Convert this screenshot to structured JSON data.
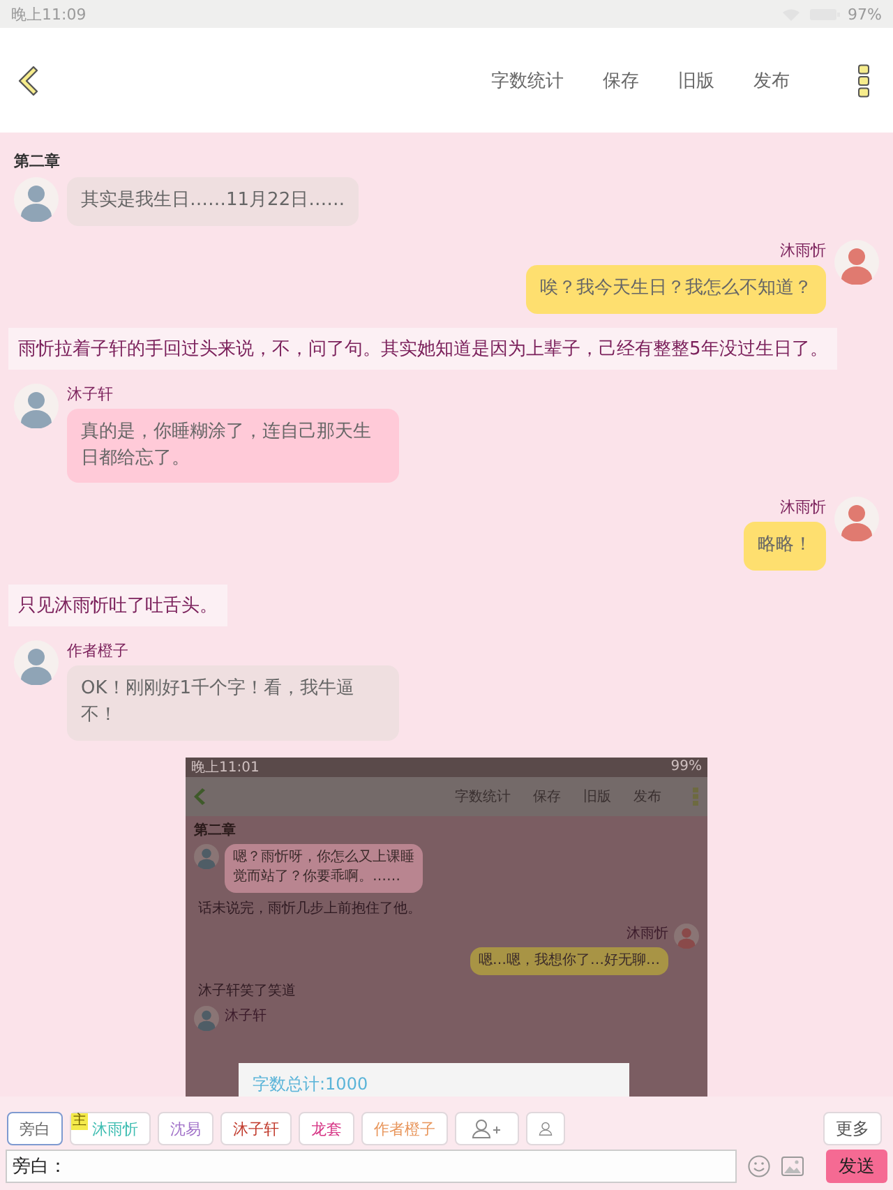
{
  "status_bar": {
    "time": "晚上11:09",
    "battery": "97%"
  },
  "toolbar": {
    "actions": [
      "字数统计",
      "保存",
      "旧版",
      "发布"
    ]
  },
  "chapter_title": "第二章",
  "messages": [
    {
      "kind": "left",
      "text": "其实是我生日……11月22日……",
      "color": "#efdfe0"
    },
    {
      "kind": "right",
      "speaker": "沐雨忻",
      "text": "唉？我今天生日？我怎么不知道？",
      "color": "#fedf6f"
    },
    {
      "kind": "narration",
      "text": "雨忻拉着子轩的手回过头来说，不，问了句。其实她知道是因为上辈子，己经有整整5年没过生日了。"
    },
    {
      "kind": "left",
      "speaker": "沐子轩",
      "text": "真的是，你睡糊涂了，连自己那天生日都给忘了。",
      "color": "#ffcad8"
    },
    {
      "kind": "right",
      "speaker": "沐雨忻",
      "text": "略略！",
      "color": "#fedf6f"
    },
    {
      "kind": "narration",
      "text": "只见沐雨忻吐了吐舌头。"
    },
    {
      "kind": "left",
      "speaker": "作者橙子",
      "text": "OK！刚刚好1千个字！看，我牛逼不！",
      "color": "#efdfe0"
    },
    {
      "kind": "screenshot",
      "screenshot": {
        "time": "晚上11:01",
        "battery": "99%",
        "actions": [
          "字数统计",
          "保存",
          "旧版",
          "发布"
        ],
        "chapter_title": "第二章",
        "messages": [
          {
            "kind": "left",
            "text": "嗯？雨忻呀，你怎么又上课睡觉而站了？你要乖啊。……",
            "color": "#b98590"
          },
          {
            "kind": "narration",
            "text": "话未说完，雨忻几步上前抱住了他。"
          },
          {
            "kind": "right",
            "speaker": "沐雨忻",
            "text": "嗯…嗯，我想你了…好无聊…",
            "color": "#a89445"
          },
          {
            "kind": "narration",
            "text": "沐子轩笑了笑道"
          },
          {
            "kind": "left",
            "speaker": "沐子轩"
          }
        ],
        "dialog": {
          "title": "字数总计:1000"
        }
      }
    }
  ],
  "chips": [
    {
      "label": "旁白",
      "selected": true,
      "color": "#666666"
    },
    {
      "label": "沐雨忻",
      "selected": false,
      "color": "#3bbcb0",
      "badge": "主"
    },
    {
      "label": "沈易",
      "selected": false,
      "color": "#a070c8"
    },
    {
      "label": "沐子轩",
      "selected": false,
      "color": "#c0392b"
    },
    {
      "label": "龙套",
      "selected": false,
      "color": "#d63384"
    },
    {
      "label": "作者橙子",
      "selected": false,
      "color": "#e8955a"
    }
  ],
  "more_button": "更多",
  "input": {
    "value": "旁白："
  },
  "send_button": "发送"
}
